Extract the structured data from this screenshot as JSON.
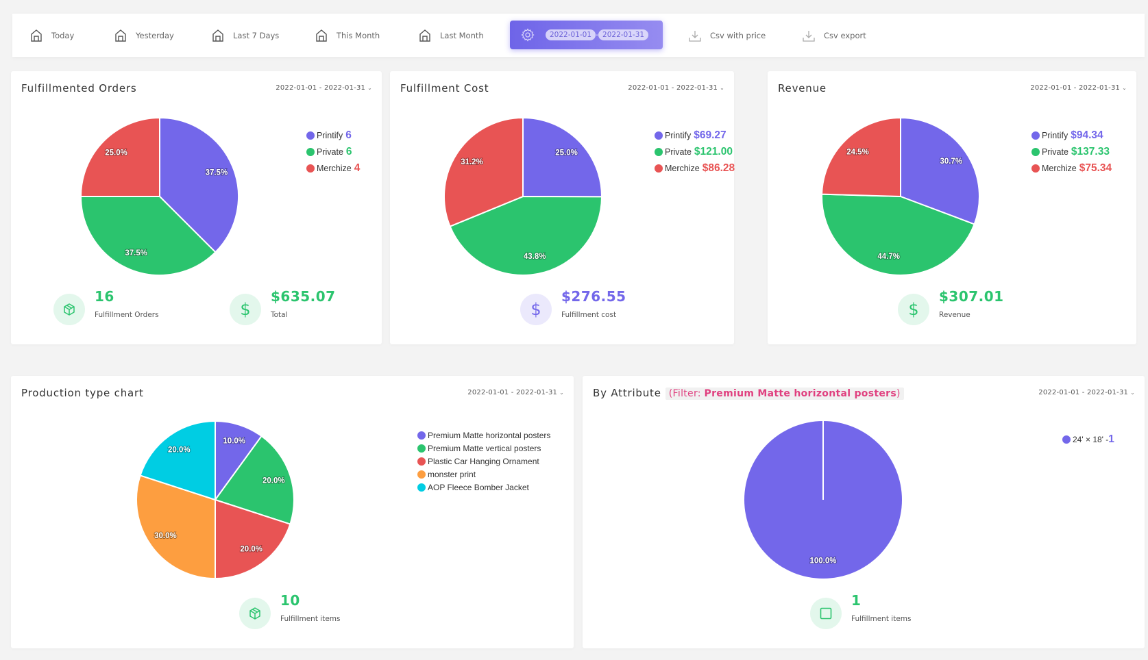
{
  "toolbar": {
    "items": [
      {
        "label": "Today",
        "icon": "home-icon"
      },
      {
        "label": "Yesterday",
        "icon": "home-icon"
      },
      {
        "label": "Last 7 Days",
        "icon": "home-icon"
      },
      {
        "label": "This Month",
        "icon": "home-icon"
      },
      {
        "label": "Last Month",
        "icon": "home-icon"
      }
    ],
    "range": {
      "icon": "gear-icon",
      "start": "2022-01-01",
      "end": "2022-01-31",
      "separator": "-"
    },
    "exports": [
      {
        "label": "Csv with price",
        "icon": "download-icon"
      },
      {
        "label": "Csv export",
        "icon": "download-icon"
      }
    ]
  },
  "colors": {
    "purple": "#7367ea",
    "green": "#2bc46e",
    "red": "#e85454",
    "orange": "#fd9e40",
    "cyan": "#00cde3",
    "stat_green_bg": "#e3f7ec",
    "stat_purple_bg": "#ebe9fc"
  },
  "cards": {
    "orders": {
      "title": "Fulfillmented Orders",
      "date_range": "2022-01-01 - 2022-01-31",
      "legend": [
        {
          "label": "Printify",
          "value": "6"
        },
        {
          "label": "Private",
          "value": "6"
        },
        {
          "label": "Merchize",
          "value": "4"
        }
      ],
      "stats": [
        {
          "value": "16",
          "label": "Fulfillment Orders",
          "icon": "box-icon"
        },
        {
          "value": "$635.07",
          "label": "Total",
          "icon": "dollar-icon"
        }
      ]
    },
    "cost": {
      "title": "Fulfillment Cost",
      "date_range": "2022-01-01 - 2022-01-31",
      "legend": [
        {
          "label": "Printify",
          "value": "$69.27"
        },
        {
          "label": "Private",
          "value": "$121.00"
        },
        {
          "label": "Merchize",
          "value": "$86.28"
        }
      ],
      "stats": [
        {
          "value": "$276.55",
          "label": "Fulfillment cost",
          "icon": "dollar-icon"
        }
      ]
    },
    "revenue": {
      "title": "Revenue",
      "date_range": "2022-01-01 - 2022-01-31",
      "legend": [
        {
          "label": "Printify",
          "value": "$94.34"
        },
        {
          "label": "Private",
          "value": "$137.33"
        },
        {
          "label": "Merchize",
          "value": "$75.34"
        }
      ],
      "stats": [
        {
          "value": "$307.01",
          "label": "Revenue",
          "icon": "dollar-icon"
        }
      ]
    },
    "production": {
      "title": "Production type chart",
      "date_range": "2022-01-01 - 2022-01-31",
      "legend": [
        {
          "label": "Premium Matte horizontal posters"
        },
        {
          "label": "Premium Matte vertical posters"
        },
        {
          "label": "Plastic Car Hanging Ornament"
        },
        {
          "label": "monster print"
        },
        {
          "label": "AOP Fleece Bomber Jacket"
        }
      ],
      "stats": [
        {
          "value": "10",
          "label": "Fulfillment items",
          "icon": "box-icon"
        }
      ]
    },
    "attribute": {
      "title": "By Attribute",
      "filter_prefix": "(Filter: ",
      "filter_value": "Premium Matte horizontal posters",
      "filter_suffix": ")",
      "date_range": "2022-01-01 - 2022-01-31",
      "legend": [
        {
          "label": "24' × 18' - ",
          "value": "1"
        }
      ],
      "stats": [
        {
          "value": "1",
          "label": "Fulfillment items",
          "icon": "square-icon"
        }
      ]
    }
  },
  "chart_data": [
    {
      "type": "pie",
      "title": "Fulfillmented Orders",
      "categories": [
        "Printify",
        "Private",
        "Merchize"
      ],
      "values": [
        6,
        6,
        4
      ],
      "labels": [
        "37.5%",
        "37.5%",
        "25.0%"
      ],
      "colors": [
        "#7367ea",
        "#2bc46e",
        "#e85454"
      ],
      "legend": "top-right"
    },
    {
      "type": "pie",
      "title": "Fulfillment Cost",
      "categories": [
        "Printify",
        "Private",
        "Merchize"
      ],
      "values": [
        69.27,
        121.0,
        86.28
      ],
      "labels": [
        "25.0%",
        "43.8%",
        "31.2%"
      ],
      "colors": [
        "#7367ea",
        "#2bc46e",
        "#e85454"
      ],
      "legend": "top-right"
    },
    {
      "type": "pie",
      "title": "Revenue",
      "categories": [
        "Printify",
        "Private",
        "Merchize"
      ],
      "values": [
        94.34,
        137.33,
        75.34
      ],
      "labels": [
        "30.7%",
        "44.7%",
        "24.5%"
      ],
      "colors": [
        "#7367ea",
        "#2bc46e",
        "#e85454"
      ],
      "legend": "top-right"
    },
    {
      "type": "pie",
      "title": "Production type chart",
      "categories": [
        "Premium Matte horizontal posters",
        "Premium Matte vertical posters",
        "Plastic Car Hanging Ornament",
        "monster print",
        "AOP Fleece Bomber Jacket"
      ],
      "values": [
        1,
        2,
        2,
        3,
        2
      ],
      "labels": [
        "10.0%",
        "20.0%",
        "20.0%",
        "30.0%",
        "20.0%"
      ],
      "colors": [
        "#7367ea",
        "#2bc46e",
        "#e85454",
        "#fd9e40",
        "#00cde3"
      ],
      "legend": "top-right"
    },
    {
      "type": "pie",
      "title": "By Attribute",
      "categories": [
        "24' × 18'"
      ],
      "values": [
        1
      ],
      "labels": [
        "100.0%"
      ],
      "colors": [
        "#7367ea"
      ],
      "legend": "top-right"
    }
  ]
}
